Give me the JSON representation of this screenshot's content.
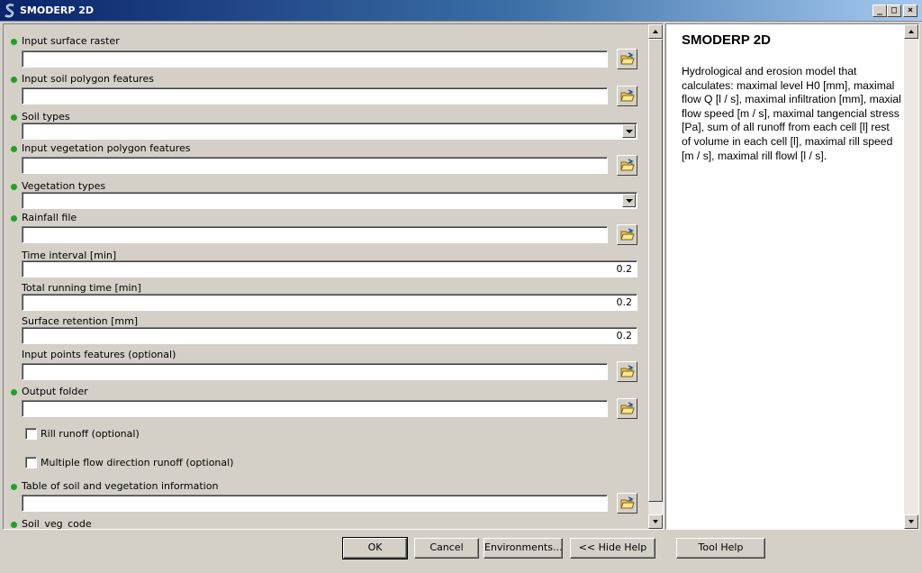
{
  "window": {
    "title": "SMODERP 2D",
    "minimize": "_",
    "maximize": "□",
    "close": "×"
  },
  "form": {
    "fields": [
      {
        "label": "Input surface raster",
        "required": true
      },
      {
        "label": "Input soil polygon features",
        "required": true
      },
      {
        "label": "Soil types",
        "required": true
      },
      {
        "label": "Input vegetation polygon features",
        "required": true
      },
      {
        "label": "Vegetation types",
        "required": true
      },
      {
        "label": "Rainfall file",
        "required": true
      },
      {
        "label": "Time interval [min]",
        "required": false,
        "value": "0.2"
      },
      {
        "label": "Total running time [min]",
        "required": false,
        "value": "0.2"
      },
      {
        "label": "Surface retention [mm]",
        "required": false,
        "value": "0.2"
      },
      {
        "label": "Input points features (optional)",
        "required": false
      },
      {
        "label": "Output folder",
        "required": true
      },
      {
        "label": "Rill runoff (optional)",
        "checked": false
      },
      {
        "label": "Multiple flow direction runoff (optional)",
        "checked": false
      },
      {
        "label": "Table of soil and vegetation information",
        "required": true
      },
      {
        "label": "Soil_veg_code",
        "required": true
      }
    ]
  },
  "help": {
    "title": "SMODERP 2D",
    "body": "Hydrological and erosion model that calculates: maximal level H0 [mm], maximal flow Q [l / s], maximal infiltration [mm], maxial flow speed [m / s], maximal tangencial stress [Pa], sum of all runoff from each cell [l] rest of volume in each cell [l], maximal rill speed [m / s], maximal rill flowl [l / s]."
  },
  "buttons": {
    "ok": "OK",
    "cancel": "Cancel",
    "environments": "Environments...",
    "hide_help": "<< Hide Help",
    "tool_help": "Tool Help"
  },
  "colors": {
    "required_dot": "#1fa31f",
    "titlebar_start": "#0a246a",
    "face": "#d4d0c8"
  }
}
